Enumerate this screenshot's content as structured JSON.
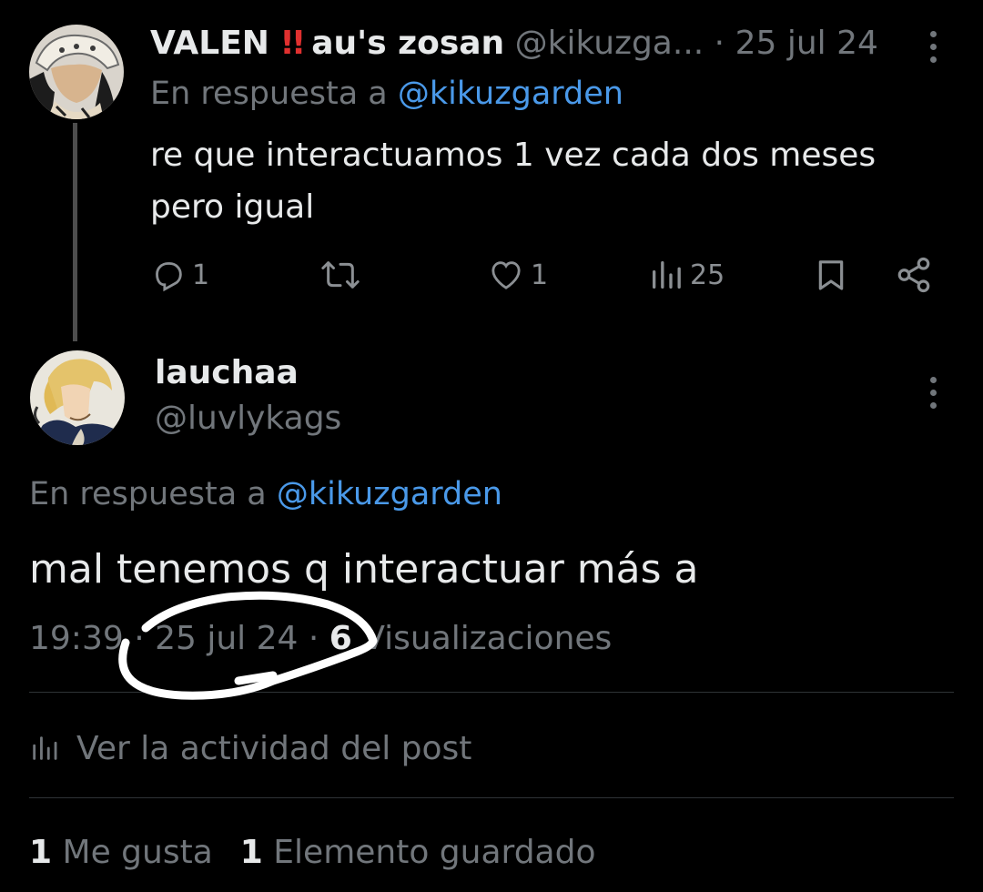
{
  "reply_tweet": {
    "display_name": "VALEN",
    "emoji": "‼️",
    "name_suffix": "au's zosan",
    "handle": "@kikuzga...",
    "separator": "·",
    "date": "25 jul 24",
    "reply_prefix": "En respuesta a",
    "reply_mention": "@kikuzgarden",
    "text": "re que interactuamos 1 vez cada dos meses pero igual",
    "actions": {
      "replies": "1",
      "reposts": "",
      "likes": "1",
      "views": "25"
    }
  },
  "main_tweet": {
    "display_name": "lauchaa",
    "handle": "@luvlykags",
    "reply_prefix": "En respuesta a",
    "reply_mention": "@kikuzgarden",
    "text": "mal tenemos q interactuar más a",
    "time": "19:39",
    "separator": "·",
    "date": "25 jul 24",
    "views_count": "6",
    "views_label": "Visualizaciones",
    "activity_label": "Ver la actividad del post",
    "likes_count": "1",
    "likes_label": "Me gusta",
    "bookmarks_count": "1",
    "bookmarks_label": "Elemento guardado"
  },
  "icons": {
    "reply": "reply-icon",
    "repost": "repost-icon",
    "like": "heart-icon",
    "views": "bar-chart-icon",
    "bookmark": "bookmark-icon",
    "share": "share-icon",
    "more": "more-vertical-icon"
  },
  "colors": {
    "background": "#000000",
    "text": "#e7e9ea",
    "muted": "#71767b",
    "link": "#4a99e9",
    "divider": "#2f3336",
    "bangbang": "#e0302f",
    "annotation": "#ffffff"
  }
}
